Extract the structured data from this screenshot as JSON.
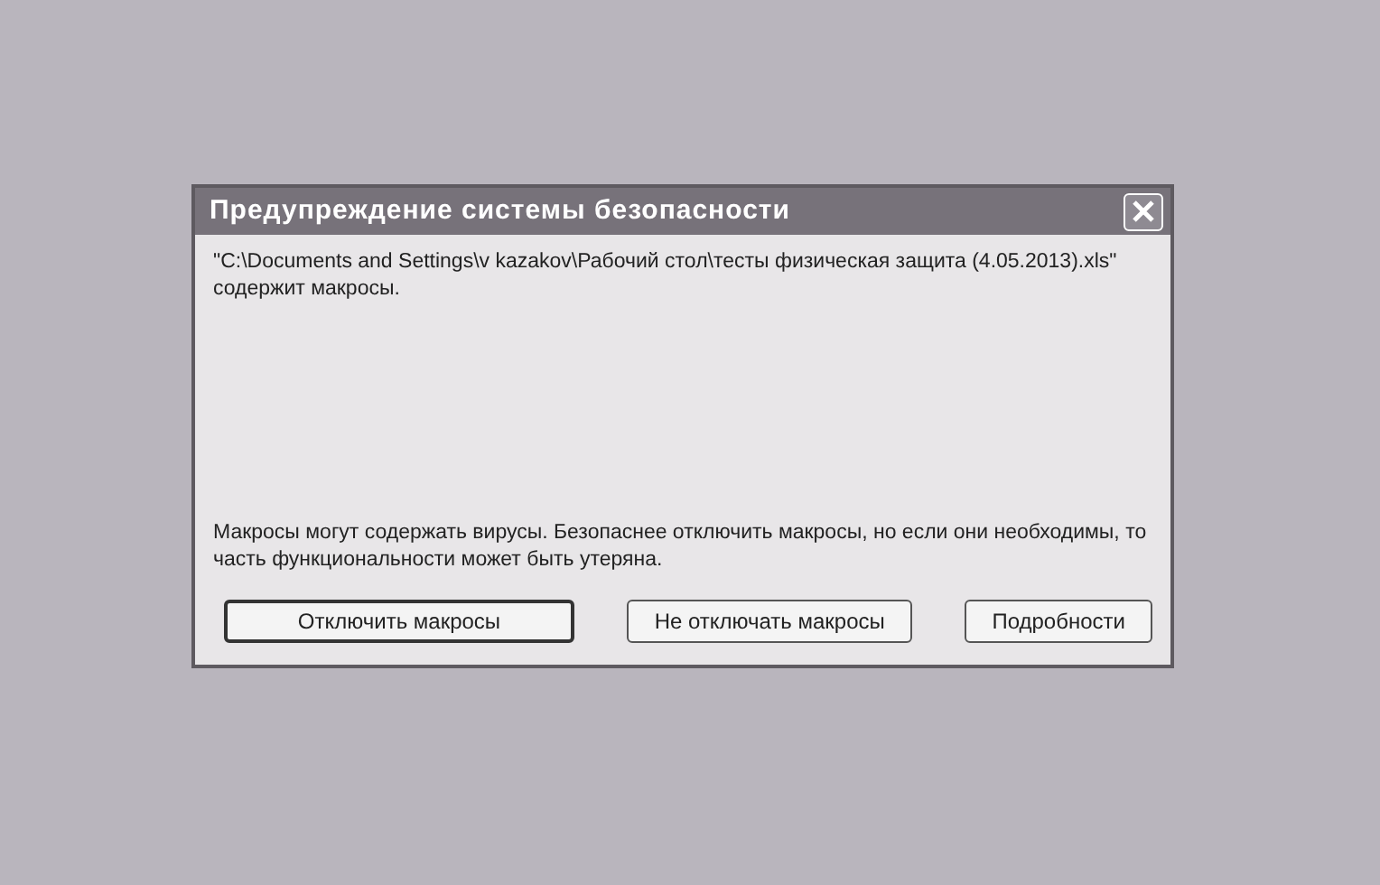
{
  "dialog": {
    "title": "Предупреждение системы безопасности",
    "message": "\"C:\\Documents and Settings\\v kazakov\\Рабочий стол\\тесты физическая защита (4.05.2013).xls\" содержит макросы.",
    "warning": "Макросы могут содержать вирусы. Безопаснее отключить макросы, но если они необходимы, то часть функциональности может быть утеряна.",
    "buttons": [
      {
        "label": "Отключить макросы",
        "default": true
      },
      {
        "label": "Не отключать макросы",
        "default": false
      },
      {
        "label": "Подробности",
        "default": false
      }
    ]
  }
}
